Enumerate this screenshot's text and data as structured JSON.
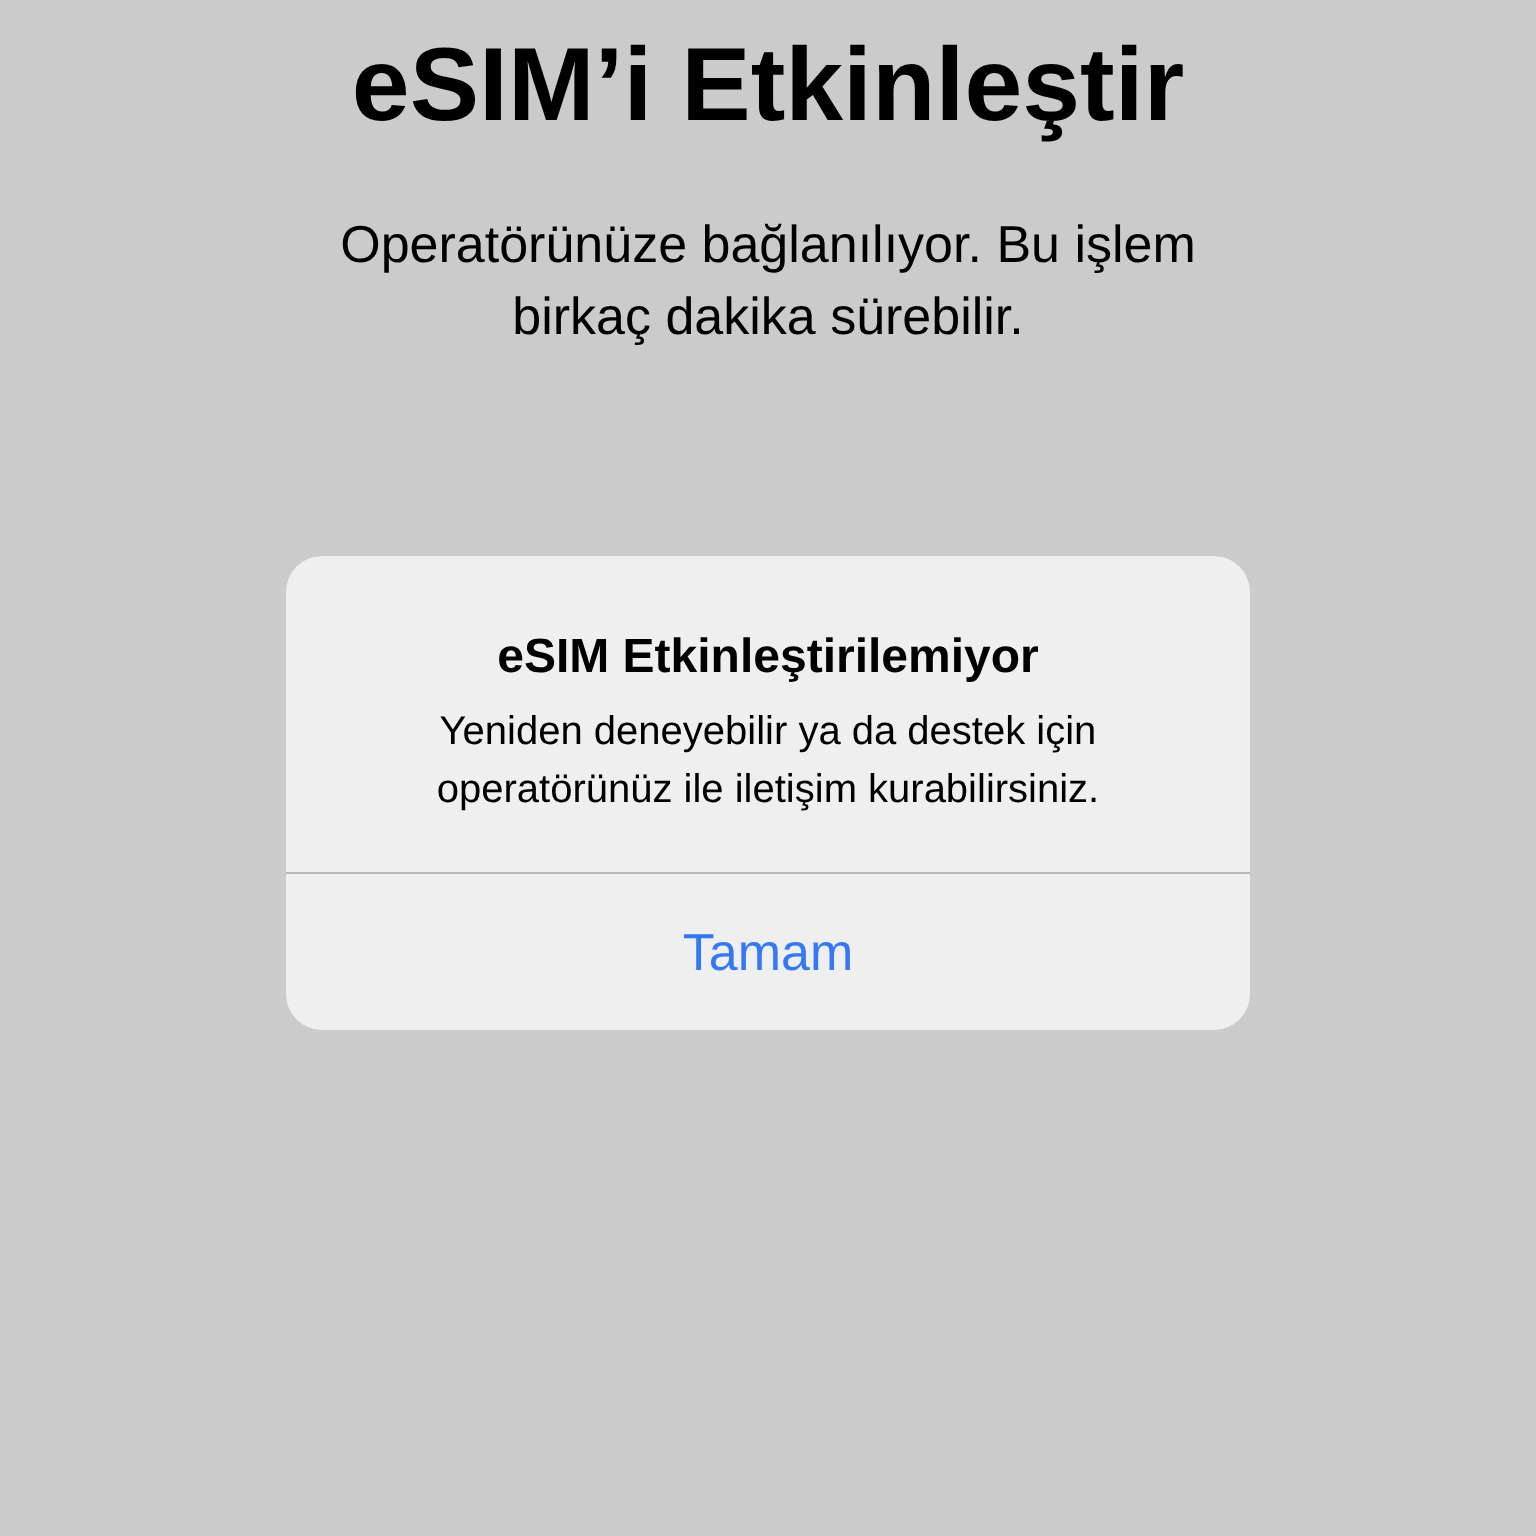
{
  "screen": {
    "title": "eSIM’i Etkinleştir",
    "subtitle": "Operatörünüze bağlanılıyor. Bu işlem birkaç dakika sürebilir."
  },
  "alert": {
    "title": "eSIM Etkinleştirilemiyor",
    "message": "Yeniden deneyebilir ya da destek için operatörünüz ile iletişim kurabilirsiniz.",
    "buttons": [
      "Tamam"
    ]
  }
}
